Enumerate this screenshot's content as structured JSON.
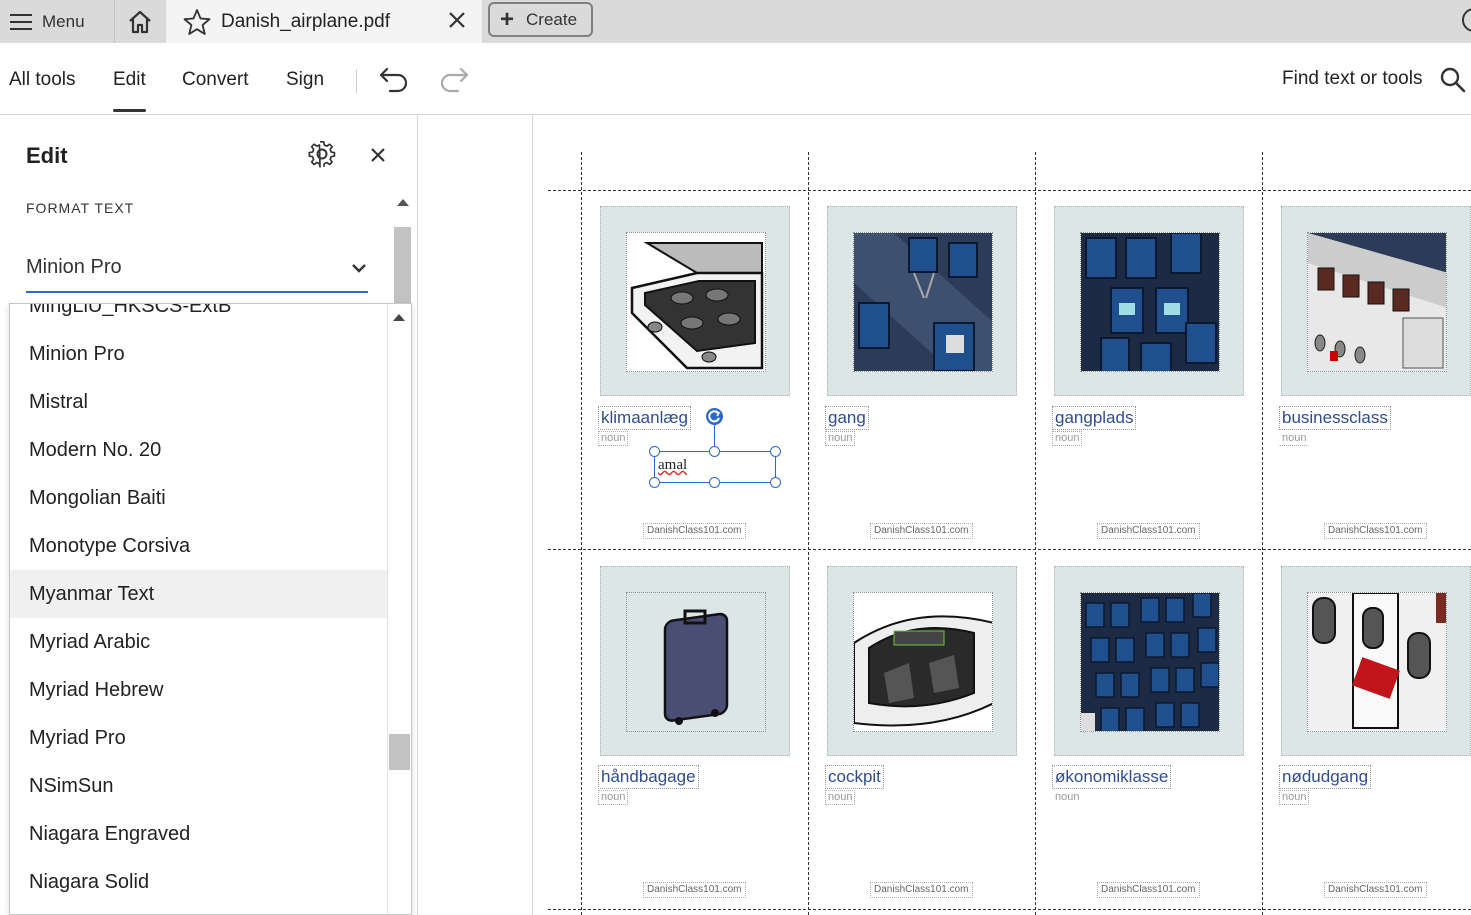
{
  "tabbar": {
    "menu_label": "Menu",
    "document_tab_title": "Danish_airplane.pdf",
    "create_label": "Create"
  },
  "toolbar": {
    "tabs": [
      "All tools",
      "Edit",
      "Convert",
      "Sign"
    ],
    "active_tab": "Edit",
    "find_label": "Find text or tools"
  },
  "panel": {
    "title": "Edit",
    "section_label": "FORMAT TEXT",
    "font_value": "Minion Pro"
  },
  "font_list": {
    "items": [
      "MingLiU_HKSCS-ExtB",
      "Minion Pro",
      "Mistral",
      "Modern No. 20",
      "Mongolian Baiti",
      "Monotype Corsiva",
      "Myanmar Text",
      "Myriad Arabic",
      "Myriad Hebrew",
      "Myriad Pro",
      "NSimSun",
      "Niagara Engraved",
      "Niagara Solid"
    ],
    "hovered": "Myanmar Text"
  },
  "document": {
    "cards": [
      {
        "word": "klimaanlæg",
        "pos": "noun",
        "footer": "DanishClass101.com"
      },
      {
        "word": "gang",
        "pos": "noun",
        "footer": "DanishClass101.com"
      },
      {
        "word": "gangplads",
        "pos": "noun",
        "footer": "DanishClass101.com"
      },
      {
        "word": "businessclass",
        "pos": "noun",
        "footer": "DanishClass101.com"
      },
      {
        "word": "håndbagage",
        "pos": "noun",
        "footer": "DanishClass101.com"
      },
      {
        "word": "cockpit",
        "pos": "noun",
        "footer": "DanishClass101.com"
      },
      {
        "word": "økonomiklasse",
        "pos": "noun",
        "footer": "DanishClass101.com"
      },
      {
        "word": "nødudgang",
        "pos": "noun",
        "footer": "DanishClass101.com"
      }
    ],
    "editing_text": "amal"
  },
  "colors": {
    "accent": "#2f68c8",
    "word_text": "#2f4d8c",
    "card_bg": "#dde6e6",
    "tabbar_bg": "#dadada"
  }
}
